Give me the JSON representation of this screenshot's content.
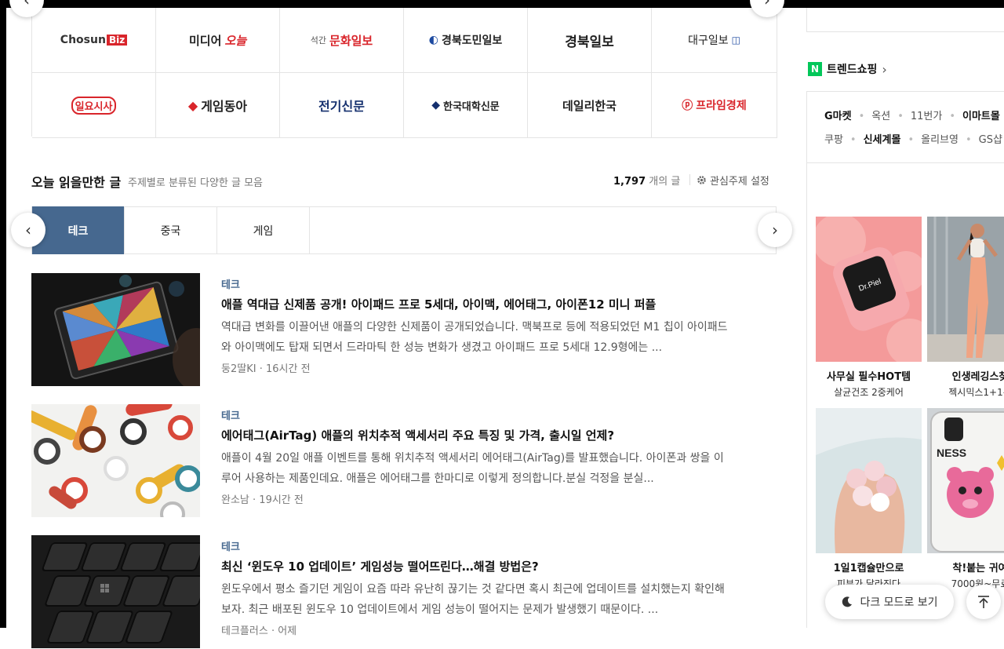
{
  "press": {
    "row1": [
      "Chosun",
      "Biz",
      "미디어",
      "오늘",
      "석간",
      "문화일보",
      "경북도민일보",
      "경북일보",
      "대구일보"
    ],
    "row2": [
      "일요시사",
      "게임동아",
      "전기신문",
      "한국대학신문",
      "데일리한국",
      "프라임경제"
    ]
  },
  "section": {
    "title": "오늘 읽을만한 글",
    "subtitle": "주제별로 분류된 다양한 글 모음",
    "count": "1,797",
    "count_unit": "개의 글",
    "setting": "관심주제 설정"
  },
  "tabs": [
    "테크",
    "중국",
    "게임"
  ],
  "articles": [
    {
      "category": "테크",
      "title": "애플 역대급 신제품 공개! 아이패드 프로 5세대, 아이맥, 에어태그, 아이폰12 미니 퍼플",
      "desc": "역대급 변화를 이끌어낸 애플의 다양한 신제품이 공개되었습니다. 맥북프로 등에 적용되었던 M1 칩이 아이패드와 아이맥에도 탑재 되면서 드라마틱 한 성능 변화가 생겼고 아이패드 프로 5세대 12.9형에는 ...",
      "author": "둥2딸KI",
      "time": "16시간 전"
    },
    {
      "category": "테크",
      "title": "에어태그(AirTag) 애플의 위치추적 액세서리 주요 특징 및 가격, 출시일 언제?",
      "desc": "애플이 4월 20일 애플 이벤트를 통해 위치추적 액세서리 에어태그(AirTag)를 발표했습니다. 아이폰과 쌍을 이루어 사용하는 제품인데요. 애플은 에어태그를 한마디로 이렇게 정의합니다.분실 걱정을 분실...",
      "author": "완소남",
      "time": "19시간 전"
    },
    {
      "category": "테크",
      "title": "최신 ‘윈도우 10 업데이트’ 게임성능 떨어뜨린다…해결 방법은?",
      "desc": "윈도우에서 평소 즐기던 게임이 요즘 따라 유난히 끊기는 것 같다면 혹시 최근에 업데이트를 설치했는지 확인해 보자. 최근 배포된 윈도우 10 업데이트에서 게임 성능이 떨어지는 문제가 발생했기 때문이다. ...",
      "author": "테크플러스",
      "time": "어제"
    }
  ],
  "trend": {
    "title": "트렌드쇼핑",
    "row1": [
      "G마켓",
      "옥션",
      "11번가",
      "이마트몰"
    ],
    "row2": [
      "쿠팡",
      "신세계몰",
      "올리브영",
      "GS샵"
    ]
  },
  "products": [
    {
      "title": "사무실 필수HOT템",
      "sub": "살균건조 2중케어"
    },
    {
      "title": "인생레깅스찾",
      "sub": "젝시믹스1+1특"
    },
    {
      "title": "1일1캡슐만으로",
      "sub": "피부가 달라진다"
    },
    {
      "title": "착!붙는 귀여",
      "sub": "7000원~무료"
    }
  ],
  "buttons": {
    "dark_mode": "다크 모드로 보기"
  },
  "colors": {
    "tab_active": "#46688f",
    "naver_green": "#03c75a",
    "logo_red": "#d9252b"
  }
}
